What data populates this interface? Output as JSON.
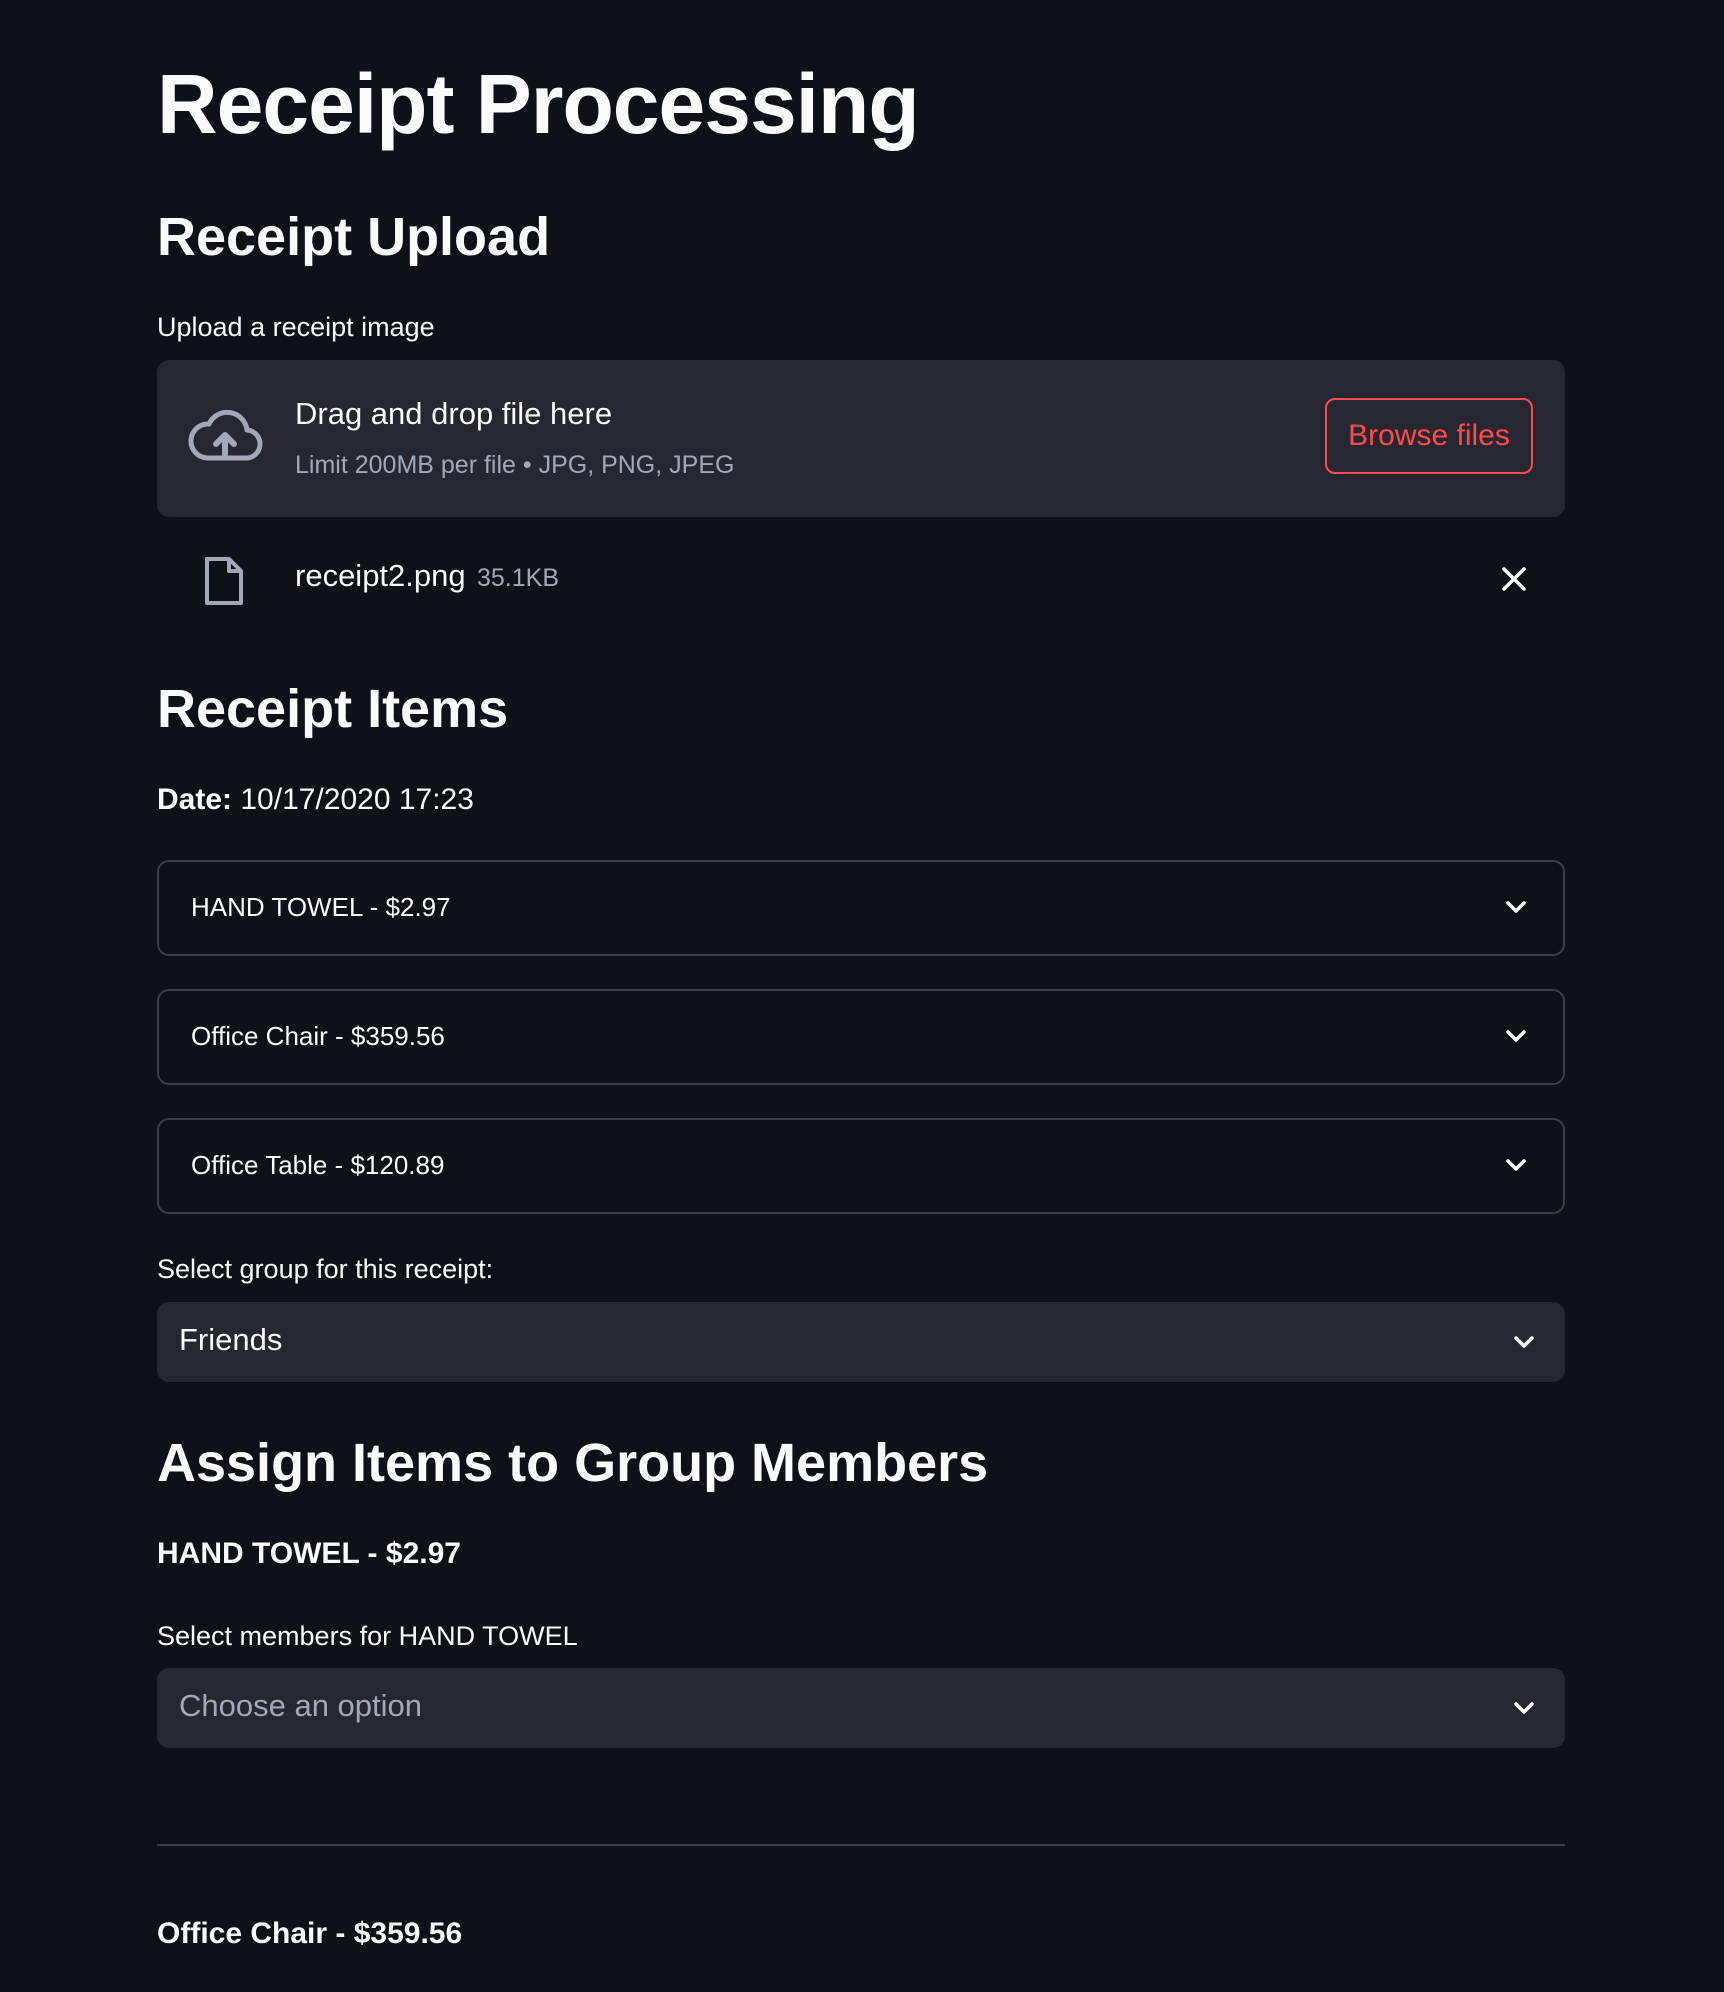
{
  "page": {
    "title": "Receipt Processing"
  },
  "upload": {
    "heading": "Receipt Upload",
    "label": "Upload a receipt image",
    "dropzone_title": "Drag and drop file here",
    "dropzone_hint": "Limit 200MB per file • JPG, PNG, JPEG",
    "browse_label": "Browse files",
    "file": {
      "name": "receipt2.png",
      "size": "35.1KB"
    }
  },
  "items": {
    "heading": "Receipt Items",
    "date_label": "Date:",
    "date_value": "10/17/2020 17:23",
    "list": [
      {
        "label": "HAND TOWEL - $2.97"
      },
      {
        "label": "Office Chair - $359.56"
      },
      {
        "label": "Office Table - $120.89"
      }
    ]
  },
  "group": {
    "label": "Select group for this receipt:",
    "selected": "Friends"
  },
  "assign": {
    "heading": "Assign Items to Group Members",
    "items": [
      {
        "title": "HAND TOWEL - $2.97",
        "select_label": "Select members for HAND TOWEL",
        "placeholder": "Choose an option"
      },
      {
        "title": "Office Chair - $359.56"
      }
    ]
  },
  "colors": {
    "background": "#0e1117",
    "surface": "#262730",
    "accent": "#ff4b4b",
    "border": "#3b3e47",
    "muted": "#a3a8b8"
  }
}
